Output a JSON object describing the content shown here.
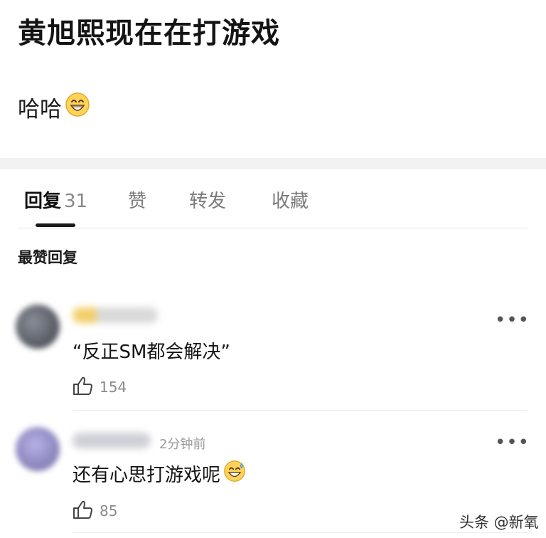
{
  "post": {
    "title": "黄旭熙现在在打游戏",
    "body": "哈哈",
    "body_emoji": "grinning-face-emoji"
  },
  "tabs": [
    {
      "label": "回复",
      "count": "31",
      "active": true
    },
    {
      "label": "赞"
    },
    {
      "label": "转发"
    },
    {
      "label": "收藏"
    }
  ],
  "section_label": "最赞回复",
  "comments": [
    {
      "text": "“反正SM都会解决”",
      "likes": "154",
      "time": ""
    },
    {
      "text": "还有心思打游戏呢",
      "text_emoji": "grinning-sweat-emoji",
      "likes": "85",
      "time": "2分钟前"
    }
  ],
  "more_icon": "more-dots-icon",
  "like_icon": "thumbs-up-icon",
  "watermark": "头条 @新氧"
}
